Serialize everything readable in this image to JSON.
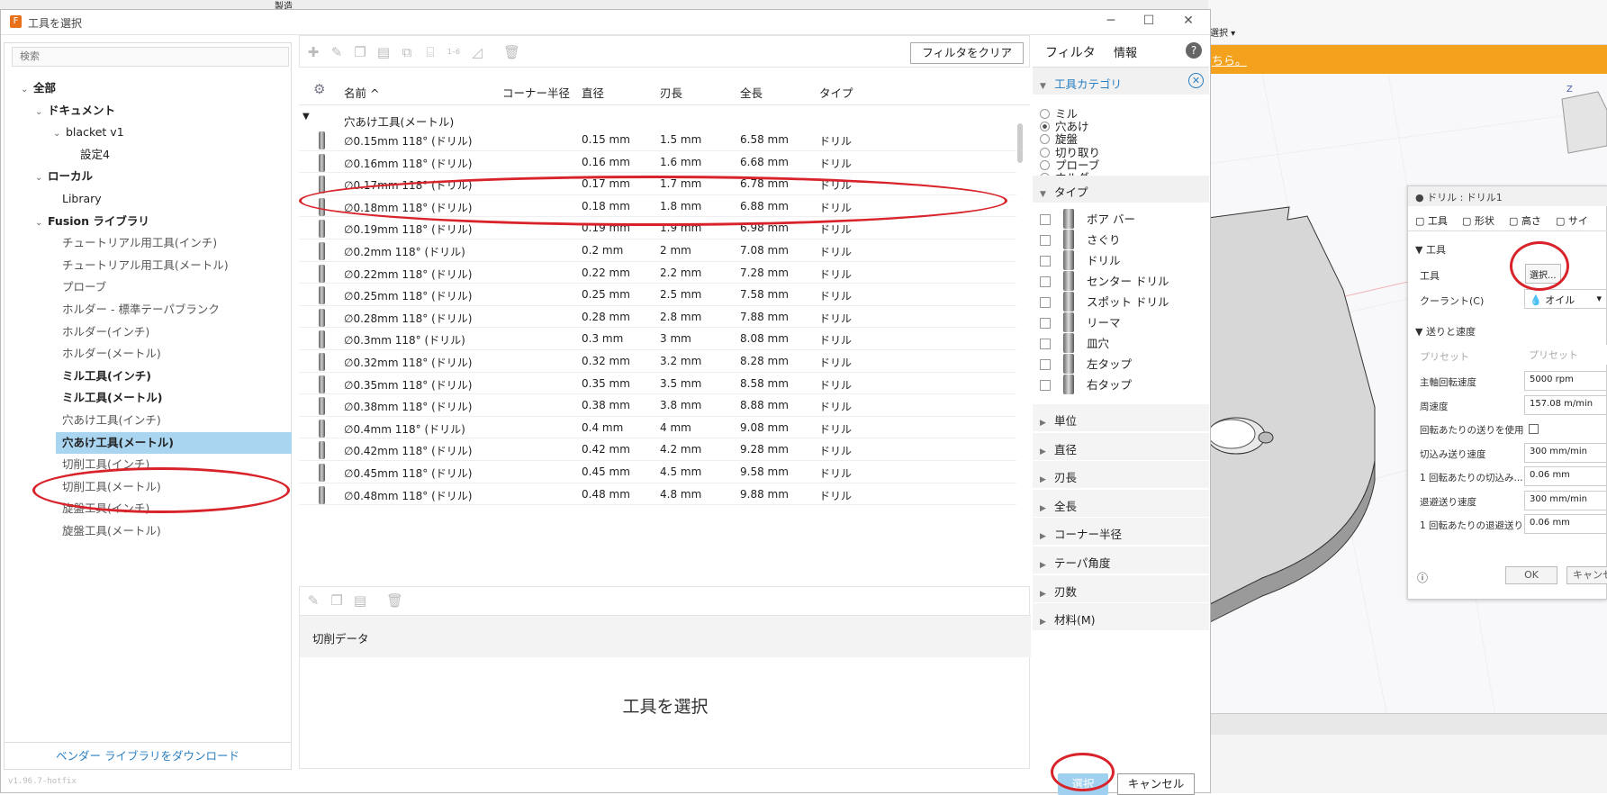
{
  "dialog": {
    "title": "工具を選択",
    "version": "v1.96.7-hotfix"
  },
  "left": {
    "search_placeholder": "検索",
    "vendor_link": "ベンダー ライブラリをダウンロード",
    "tree": [
      {
        "label": "全部",
        "caret": "⌄",
        "level": 0,
        "bold": true
      },
      {
        "label": "ドキュメント",
        "caret": "⌄",
        "level": 1,
        "bold": true
      },
      {
        "label": "blacket v1",
        "caret": "⌄",
        "level": 2,
        "bold": false
      },
      {
        "label": "設定4",
        "caret": "",
        "level": 3,
        "bold": false
      },
      {
        "label": "ローカル",
        "caret": "⌄",
        "level": 1,
        "bold": true
      },
      {
        "label": "Library",
        "caret": "",
        "level": 2,
        "bold": false
      },
      {
        "label": "Fusion ライブラリ",
        "caret": "⌄",
        "level": 1,
        "bold": true
      },
      {
        "label": "チュートリアル用工具(インチ)",
        "caret": "",
        "level": 2,
        "bold": false
      },
      {
        "label": "チュートリアル用工具(メートル)",
        "caret": "",
        "level": 2,
        "bold": false
      },
      {
        "label": "プローブ",
        "caret": "",
        "level": 2,
        "bold": false
      },
      {
        "label": "ホルダー - 標準テーパブランク",
        "caret": "",
        "level": 2,
        "bold": false
      },
      {
        "label": "ホルダー(インチ)",
        "caret": "",
        "level": 2,
        "bold": false
      },
      {
        "label": "ホルダー(メートル)",
        "caret": "",
        "level": 2,
        "bold": false
      },
      {
        "label": "ミル工具(インチ)",
        "caret": "",
        "level": 2,
        "bold": true
      },
      {
        "label": "ミル工具(メートル)",
        "caret": "",
        "level": 2,
        "bold": true
      },
      {
        "label": "穴あけ工具(インチ)",
        "caret": "",
        "level": 2,
        "bold": false
      },
      {
        "label": "穴あけ工具(メートル)",
        "caret": "",
        "level": 2,
        "bold": true,
        "selected": true
      },
      {
        "label": "切削工具(インチ)",
        "caret": "",
        "level": 2,
        "bold": false
      },
      {
        "label": "切削工具(メートル)",
        "caret": "",
        "level": 2,
        "bold": false
      },
      {
        "label": "旋盤工具(インチ)",
        "caret": "",
        "level": 2,
        "bold": false
      },
      {
        "label": "旋盤工具(メートル)",
        "caret": "",
        "level": 2,
        "bold": false
      }
    ]
  },
  "toolbar": {
    "clear_filter": "フィルタをクリア"
  },
  "table": {
    "columns": {
      "name": "名前 ^",
      "corner": "コーナー半径",
      "diameter": "直径",
      "flute": "刃長",
      "overall": "全長",
      "type": "タイプ"
    },
    "group": "穴あけ工具(メートル)",
    "rows": [
      {
        "name": "∅0.15mm 118° (ドリル)",
        "diameter": "0.15 mm",
        "flute": "1.5 mm",
        "overall": "6.58 mm",
        "type": "ドリル"
      },
      {
        "name": "∅0.16mm 118° (ドリル)",
        "diameter": "0.16 mm",
        "flute": "1.6 mm",
        "overall": "6.68 mm",
        "type": "ドリル"
      },
      {
        "name": "∅0.17mm 118° (ドリル)",
        "diameter": "0.17 mm",
        "flute": "1.7 mm",
        "overall": "6.78 mm",
        "type": "ドリル"
      },
      {
        "name": "∅0.18mm 118° (ドリル)",
        "diameter": "0.18 mm",
        "flute": "1.8 mm",
        "overall": "6.88 mm",
        "type": "ドリル"
      },
      {
        "name": "∅0.19mm 118° (ドリル)",
        "diameter": "0.19 mm",
        "flute": "1.9 mm",
        "overall": "6.98 mm",
        "type": "ドリル"
      },
      {
        "name": "∅0.2mm 118° (ドリル)",
        "diameter": "0.2 mm",
        "flute": "2 mm",
        "overall": "7.08 mm",
        "type": "ドリル"
      },
      {
        "name": "∅0.22mm 118° (ドリル)",
        "diameter": "0.22 mm",
        "flute": "2.2 mm",
        "overall": "7.28 mm",
        "type": "ドリル"
      },
      {
        "name": "∅0.25mm 118° (ドリル)",
        "diameter": "0.25 mm",
        "flute": "2.5 mm",
        "overall": "7.58 mm",
        "type": "ドリル"
      },
      {
        "name": "∅0.28mm 118° (ドリル)",
        "diameter": "0.28 mm",
        "flute": "2.8 mm",
        "overall": "7.88 mm",
        "type": "ドリル"
      },
      {
        "name": "∅0.3mm 118° (ドリル)",
        "diameter": "0.3 mm",
        "flute": "3 mm",
        "overall": "8.08 mm",
        "type": "ドリル"
      },
      {
        "name": "∅0.32mm 118° (ドリル)",
        "diameter": "0.32 mm",
        "flute": "3.2 mm",
        "overall": "8.28 mm",
        "type": "ドリル"
      },
      {
        "name": "∅0.35mm 118° (ドリル)",
        "diameter": "0.35 mm",
        "flute": "3.5 mm",
        "overall": "8.58 mm",
        "type": "ドリル"
      },
      {
        "name": "∅0.38mm 118° (ドリル)",
        "diameter": "0.38 mm",
        "flute": "3.8 mm",
        "overall": "8.88 mm",
        "type": "ドリル"
      },
      {
        "name": "∅0.4mm 118° (ドリル)",
        "diameter": "0.4 mm",
        "flute": "4 mm",
        "overall": "9.08 mm",
        "type": "ドリル"
      },
      {
        "name": "∅0.42mm 118° (ドリル)",
        "diameter": "0.42 mm",
        "flute": "4.2 mm",
        "overall": "9.28 mm",
        "type": "ドリル"
      },
      {
        "name": "∅0.45mm 118° (ドリル)",
        "diameter": "0.45 mm",
        "flute": "4.5 mm",
        "overall": "9.58 mm",
        "type": "ドリル"
      },
      {
        "name": "∅0.48mm 118° (ドリル)",
        "diameter": "0.48 mm",
        "flute": "4.8 mm",
        "overall": "9.88 mm",
        "type": "ドリル"
      }
    ]
  },
  "lower": {
    "cut_data": "切削データ",
    "placeholder": "工具を選択"
  },
  "filter": {
    "tab_filter": "フィルタ",
    "tab_info": "情報",
    "category_title": "工具カテゴリ",
    "categories": [
      {
        "label": "ミル",
        "checked": false
      },
      {
        "label": "穴あけ",
        "checked": true
      },
      {
        "label": "旋盤",
        "checked": false
      },
      {
        "label": "切り取り",
        "checked": false
      },
      {
        "label": "プローブ",
        "checked": false
      },
      {
        "label": "ホルダー",
        "checked": false
      }
    ],
    "type_title": "タイプ",
    "types": [
      "ボア バー",
      "さぐり",
      "ドリル",
      "センター ドリル",
      "スポット ドリル",
      "リーマ",
      "皿穴",
      "左タップ",
      "右タップ"
    ],
    "sections": [
      "単位",
      "直径",
      "刃長",
      "全長",
      "コーナー半径",
      "テーパ角度",
      "刃数",
      "材料(M)"
    ]
  },
  "buttons": {
    "select": "選択",
    "cancel": "キャンセル"
  },
  "cad": {
    "toolbar_label": "製造",
    "select_label": "選択 ▾",
    "banner": "ちら。"
  },
  "drill_panel": {
    "title": "ドリル : ドリル1",
    "tabs": [
      "工具",
      "形状",
      "高さ",
      "サイ"
    ],
    "tool_section": "工具",
    "tool_label": "工具",
    "select_button": "選択...",
    "coolant_label": "クーラント(C)",
    "coolant_value": "オイル",
    "feed_section": "送りと速度",
    "preset_label": "プリセット",
    "preset_value": "プリセット",
    "fields": [
      {
        "label": "主軸回転速度",
        "value": "5000 rpm"
      },
      {
        "label": "周速度",
        "value": "157.08 m/min"
      },
      {
        "label": "回転あたりの送りを使用",
        "value": ""
      },
      {
        "label": "切込み送り速度",
        "value": "300 mm/min"
      },
      {
        "label": "1 回転あたりの切込み...",
        "value": "0.06 mm"
      },
      {
        "label": "退避送り速度",
        "value": "300 mm/min"
      },
      {
        "label": "1 回転あたりの退避送り",
        "value": "0.06 mm"
      }
    ],
    "ok": "OK",
    "cancel": "キャンセ"
  },
  "colors": {
    "accent": "#2a7fc1",
    "selection": "#a9d5f0",
    "highlight": "#d8232a",
    "banner": "#f4a21e"
  }
}
